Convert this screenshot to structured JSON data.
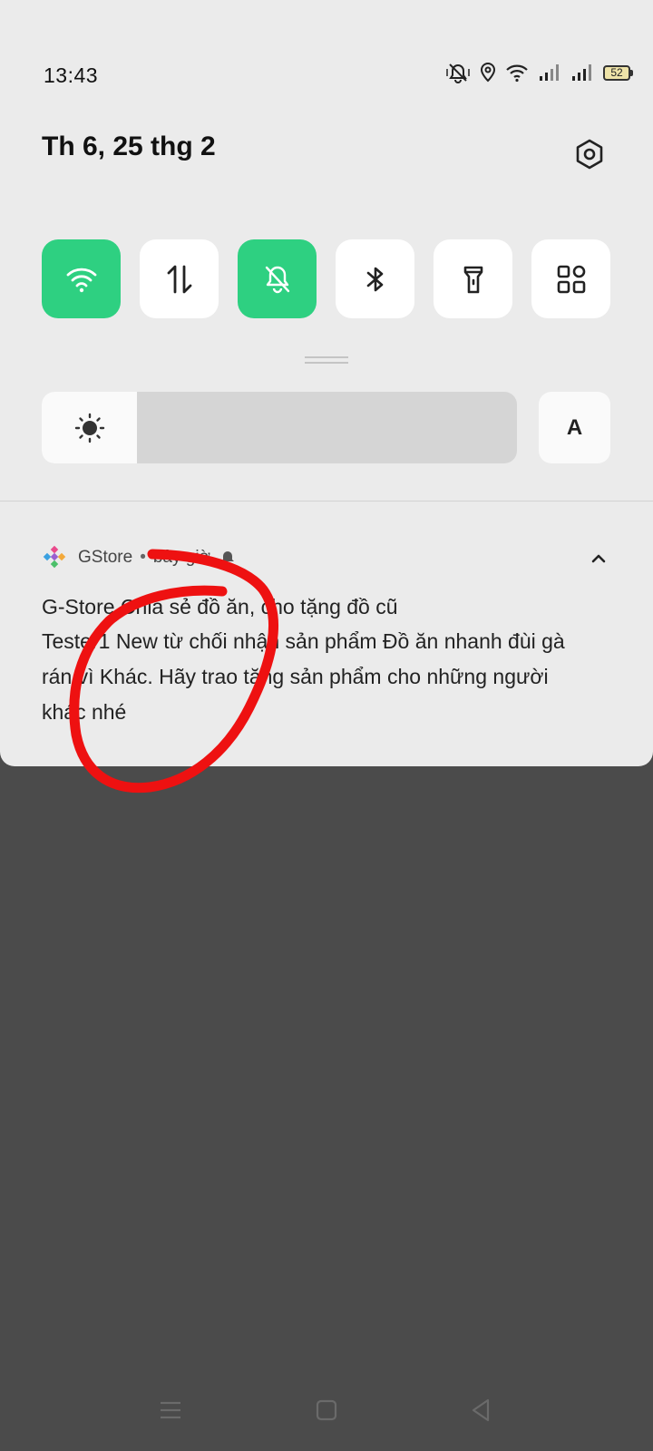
{
  "status_bar": {
    "time": "13:43",
    "battery_level": "52",
    "icons": [
      "mute-vibrate-icon",
      "location-icon",
      "wifi-icon",
      "signal-icon",
      "signal-icon",
      "battery-icon"
    ]
  },
  "header": {
    "date": "Th 6, 25 thg 2"
  },
  "quick_tiles": [
    {
      "name": "wifi",
      "active": true
    },
    {
      "name": "mobile-data",
      "active": false
    },
    {
      "name": "silent-mode",
      "active": true
    },
    {
      "name": "bluetooth",
      "active": false
    },
    {
      "name": "flashlight",
      "active": false
    },
    {
      "name": "more-tiles",
      "active": false
    }
  ],
  "brightness": {
    "level": 0.2,
    "auto_label": "A"
  },
  "notification": {
    "app_name": "GStore",
    "separator": "•",
    "time": "bây giờ",
    "title": "G-Store Chia sẻ đồ ăn, cho tặng đồ cũ",
    "body": "Tester1 New từ chối nhận sản phẩm Đồ ăn nhanh đùi gà rán  vì Khác. Hãy trao tặng sản phẩm cho những người khác nhé"
  },
  "colors": {
    "active_tile": "#2ed081",
    "panel_bg": "#ebebeb",
    "backdrop": "#4b4b4b",
    "annotation": "#ee1111"
  },
  "nav_bar": [
    "menu-icon",
    "home-icon",
    "back-icon"
  ]
}
